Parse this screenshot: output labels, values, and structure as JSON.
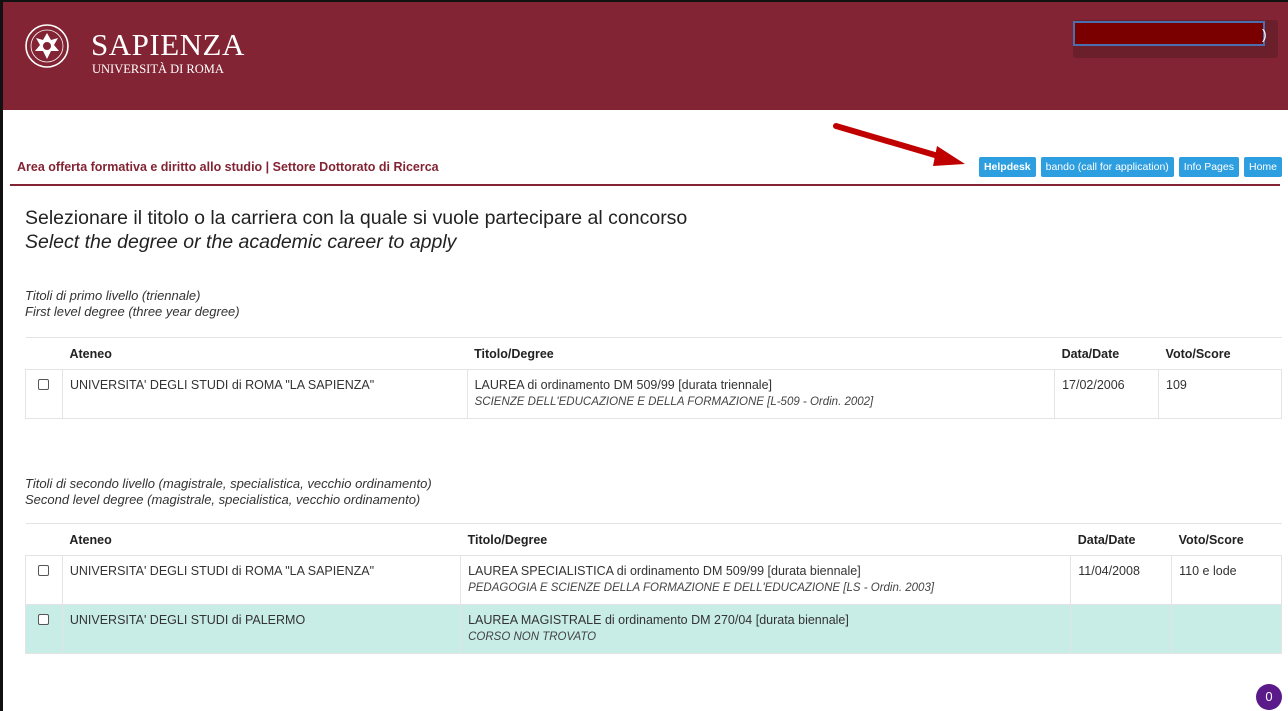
{
  "header": {
    "brand_name": "SAPIENZA",
    "brand_sub": "UNIVERSITÀ DI ROMA",
    "user_paren": ")"
  },
  "section_title": "Area offerta formativa e diritto allo studio | Settore Dottorato di Ricerca",
  "nav": [
    {
      "label": "Helpdesk"
    },
    {
      "label": "bando (call for application)"
    },
    {
      "label": "Info Pages"
    },
    {
      "label": "Home"
    }
  ],
  "heading": {
    "it": "Selezionare il titolo o la carriera con la quale si vuole partecipare al concorso",
    "en": "Select the degree or the academic career to apply"
  },
  "first_level": {
    "title_it": "Titoli di primo livello (triennale)",
    "title_en": "First level degree (three year degree)",
    "columns": [
      "Ateneo",
      "Titolo/Degree",
      "Data/Date",
      "Voto/Score"
    ],
    "rows": [
      {
        "ateneo": "UNIVERSITA' DEGLI STUDI di ROMA \"LA SAPIENZA\"",
        "titolo": "LAUREA di ordinamento DM 509/99 [durata triennale]",
        "corso": "SCIENZE DELL'EDUCAZIONE E DELLA FORMAZIONE [L-509 - Ordin. 2002]",
        "data": "17/02/2006",
        "voto": "109"
      }
    ]
  },
  "second_level": {
    "title_it": "Titoli di secondo livello (magistrale, specialistica, vecchio ordinamento)",
    "title_en": "Second level degree (magistrale, specialistica, vecchio ordinamento)",
    "columns": [
      "Ateneo",
      "Titolo/Degree",
      "Data/Date",
      "Voto/Score"
    ],
    "rows": [
      {
        "ateneo": "UNIVERSITA' DEGLI STUDI di ROMA \"LA SAPIENZA\"",
        "titolo": "LAUREA SPECIALISTICA di ordinamento DM 509/99 [durata biennale]",
        "corso": "PEDAGOGIA E SCIENZE DELLA FORMAZIONE E DELL'EDUCAZIONE [LS - Ordin. 2003]",
        "data": "11/04/2008",
        "voto": "110 e lode"
      },
      {
        "ateneo": "UNIVERSITA' DEGLI STUDI di PALERMO",
        "titolo": "LAUREA MAGISTRALE di ordinamento DM 270/04 [durata biennale]",
        "corso": "CORSO NON TROVATO",
        "data": "",
        "voto": ""
      }
    ]
  },
  "chat_badge": "0",
  "colors": {
    "brand": "#822433",
    "button": "#2d9fe0",
    "highlight_row": "#c8ece6",
    "arrow": "#c00000"
  }
}
